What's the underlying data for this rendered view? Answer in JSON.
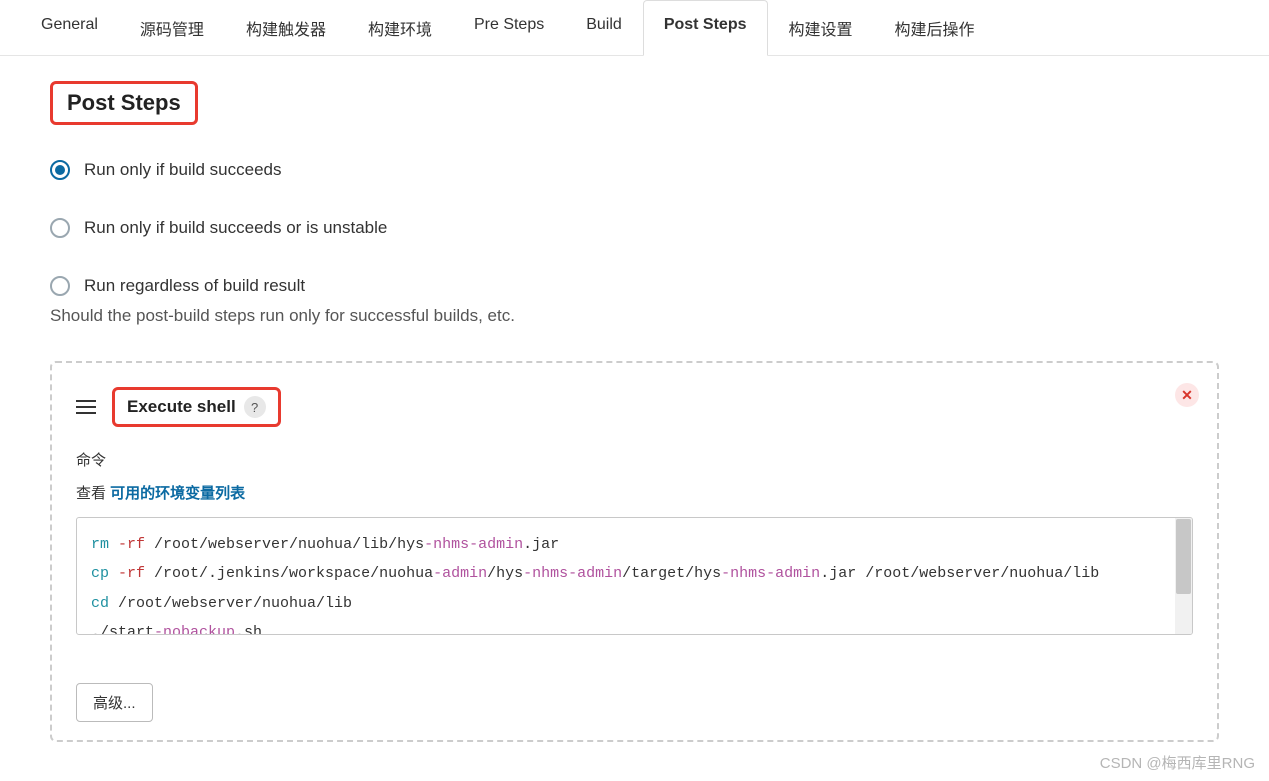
{
  "tabs": {
    "general": "General",
    "scm": "源码管理",
    "triggers": "构建触发器",
    "env": "构建环境",
    "pre": "Pre Steps",
    "build": "Build",
    "post": "Post Steps",
    "settings": "构建设置",
    "postbuild": "构建后操作"
  },
  "section": {
    "title": "Post Steps",
    "opt1": "Run only if build succeeds",
    "opt2": "Run only if build succeeds or is unstable",
    "opt3": "Run regardless of build result",
    "help": "Should the post-build steps run only for successful builds, etc."
  },
  "step": {
    "title": "Execute shell",
    "help_badge": "?",
    "close": "✕",
    "cmd_label": "命令",
    "env_prefix": "查看 ",
    "env_link": "可用的环境变量列表"
  },
  "code": {
    "line1_a": "rm",
    "line1_b": " -rf",
    "line1_c": " /root/webserver/nuohua/lib/hys",
    "line1_d": "-nhms-admin",
    "line1_e": ".jar",
    "line2_a": "cp",
    "line2_b": " -rf",
    "line2_c": " /root/.jenkins/workspace/nuohua",
    "line2_d": "-admin",
    "line2_e": "/hys",
    "line2_f": "-nhms-admin",
    "line2_g": "/target/hys",
    "line2_h": "-nhms-admin",
    "line2_i": ".jar /root/webserver/nuohua/lib",
    "line3_a": "cd",
    "line3_b": " /root/webserver/nuohua/lib",
    "line4_a": "./start",
    "line4_b": "-nobackup",
    "line4_c": ".sh"
  },
  "advanced": "高级...",
  "watermark": "CSDN @梅西库里RNG"
}
